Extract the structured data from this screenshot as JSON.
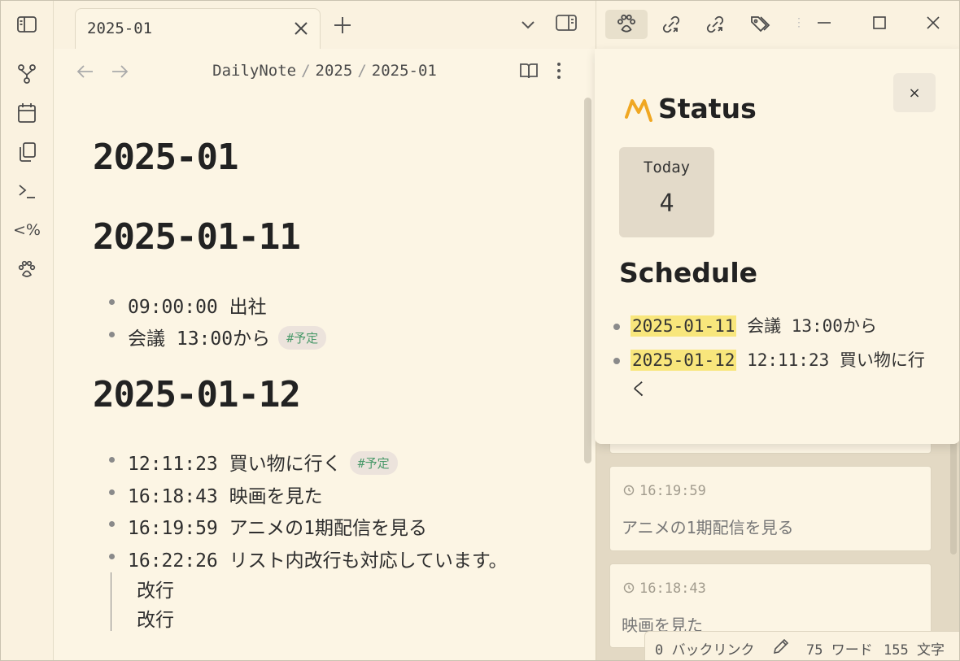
{
  "tab": {
    "title": "2025-01"
  },
  "breadcrumb": {
    "root": "DailyNote",
    "year": "2025",
    "month": "2025-01"
  },
  "note": {
    "title": "2025-01",
    "sections": [
      {
        "heading": "2025-01-11",
        "items": [
          {
            "text": "09:00:00 出社"
          },
          {
            "text": "会議 13:00から",
            "tag": "#予定"
          }
        ]
      },
      {
        "heading": "2025-01-12",
        "items": [
          {
            "text": "12:11:23 買い物に行く",
            "tag": "#予定"
          },
          {
            "text": "16:18:43 映画を見た"
          },
          {
            "text": "16:19:59 アニメの1期配信を見る"
          },
          {
            "text": "16:22:26 リスト内改行も対応しています。"
          }
        ],
        "continuation": [
          "改行",
          "改行"
        ]
      }
    ]
  },
  "popup": {
    "close_label": "×",
    "title": "Status",
    "stat": {
      "label": "Today",
      "value": "4"
    },
    "schedule_title": "Schedule",
    "schedule": [
      {
        "date": "2025-01-11",
        "text": "会議 13:00から"
      },
      {
        "date": "2025-01-12",
        "text": "12:11:23 買い物に行く"
      }
    ]
  },
  "timeline": [
    {
      "time": "16:19:59",
      "text": "アニメの1期配信を見る"
    },
    {
      "time": "16:18:43",
      "text": "映画を見た"
    }
  ],
  "statusbar": {
    "backlinks": "0 バックリンク",
    "words": "75 ワード",
    "chars": "155 文字"
  },
  "colors": {
    "background": "#fcf5e4",
    "sidebar": "#e3d9c4",
    "highlight": "#f8e67c",
    "tag_text": "#4b9a6b",
    "logo": "#f0a722"
  }
}
